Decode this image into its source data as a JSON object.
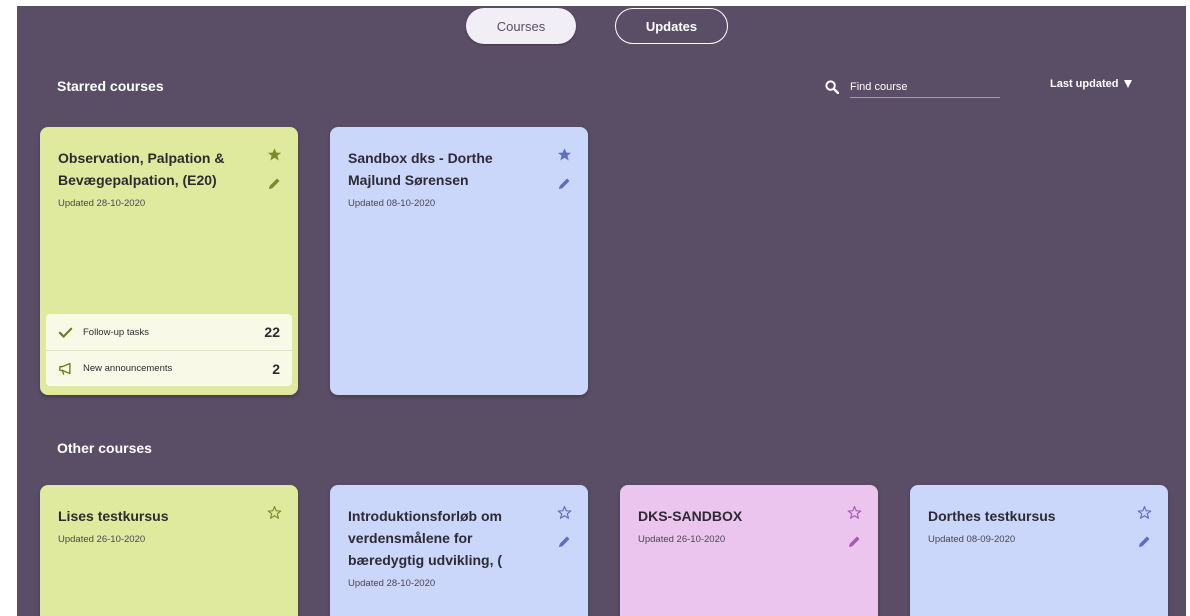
{
  "tabs": {
    "courses": "Courses",
    "updates": "Updates"
  },
  "starred": {
    "title": "Starred courses",
    "search_placeholder": "Find course",
    "sort_label": "Last updated"
  },
  "starred_courses": [
    {
      "title": "Observation, Palpation & Bevægepalpation, (E20)",
      "updated": "Updated 28-10-2020",
      "color": "#dfea9e",
      "followup_label": "Follow-up tasks",
      "followup_count": "22",
      "announcements_label": "New announcements",
      "announcements_count": "2"
    },
    {
      "title": "Sandbox dks - Dorthe Majlund Sørensen",
      "updated": "Updated 08-10-2020",
      "color": "#cbd6fb"
    }
  ],
  "other": {
    "title": "Other courses"
  },
  "other_courses": [
    {
      "title": "Lises testkursus",
      "updated": "Updated 26-10-2020",
      "color": "#dfea9e"
    },
    {
      "title": "Introduktionsforløb om verdensmålene for bæredygtig udvikling, (",
      "updated": "Updated 28-10-2020",
      "color": "#cbd6fb"
    },
    {
      "title": "DKS-SANDBOX",
      "updated": "Updated 26-10-2020",
      "color": "#ecc5ee"
    },
    {
      "title": "Dorthes testkursus",
      "updated": "Updated 08-09-2020",
      "color": "#cbd6fb"
    }
  ],
  "colors": {
    "background": "#5a4e67",
    "green_icon": "#7f8a2c",
    "blue_icon": "#5f6cc4",
    "pink_icon": "#a758b5"
  },
  "icons": {
    "search": "search-icon",
    "star_filled": "star-filled-icon",
    "star_outline": "star-outline-icon",
    "edit": "pencil-icon",
    "check": "check-icon",
    "megaphone": "megaphone-icon",
    "sort": "triangle-down-icon"
  }
}
